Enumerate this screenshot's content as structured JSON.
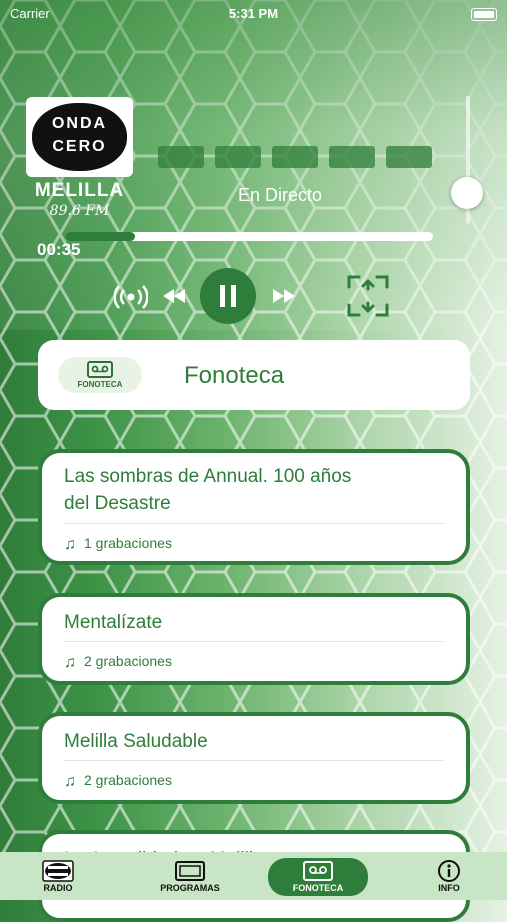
{
  "status_bar": {
    "carrier": "Carrier",
    "time": "5:31 PM"
  },
  "player": {
    "logo_top": "ONDA",
    "logo_bottom": "CERO",
    "city": "MELILLA",
    "frequency": "89.6 FM",
    "live_label": "En Directo",
    "elapsed": "00:35",
    "progress_fraction": 0.19,
    "volume_fraction": 0.3
  },
  "section": {
    "pill_label": "FONOTECA",
    "title": "Fonoteca"
  },
  "items": [
    {
      "title_line1": "Las sombras de Annual. 100 años",
      "title_line2": "del Desastre",
      "count": "1 grabaciones"
    },
    {
      "title_line1": "Mentalízate",
      "count": "2 grabaciones"
    },
    {
      "title_line1": "Melilla Saludable",
      "count": "2 grabaciones"
    },
    {
      "title_line1": "La Actualidad en Melilla"
    }
  ],
  "tabs": [
    {
      "label": "RADIO",
      "icon": "radio-logo-icon"
    },
    {
      "label": "PROGRAMAS",
      "icon": "tv-icon"
    },
    {
      "label": "FONOTECA",
      "icon": "cassette-icon",
      "active": true
    },
    {
      "label": "INFO",
      "icon": "info-icon"
    }
  ],
  "colors": {
    "primary": "#2f7d3a",
    "tab_bg": "#c8e6c5",
    "card_bg": "#ffffff"
  }
}
